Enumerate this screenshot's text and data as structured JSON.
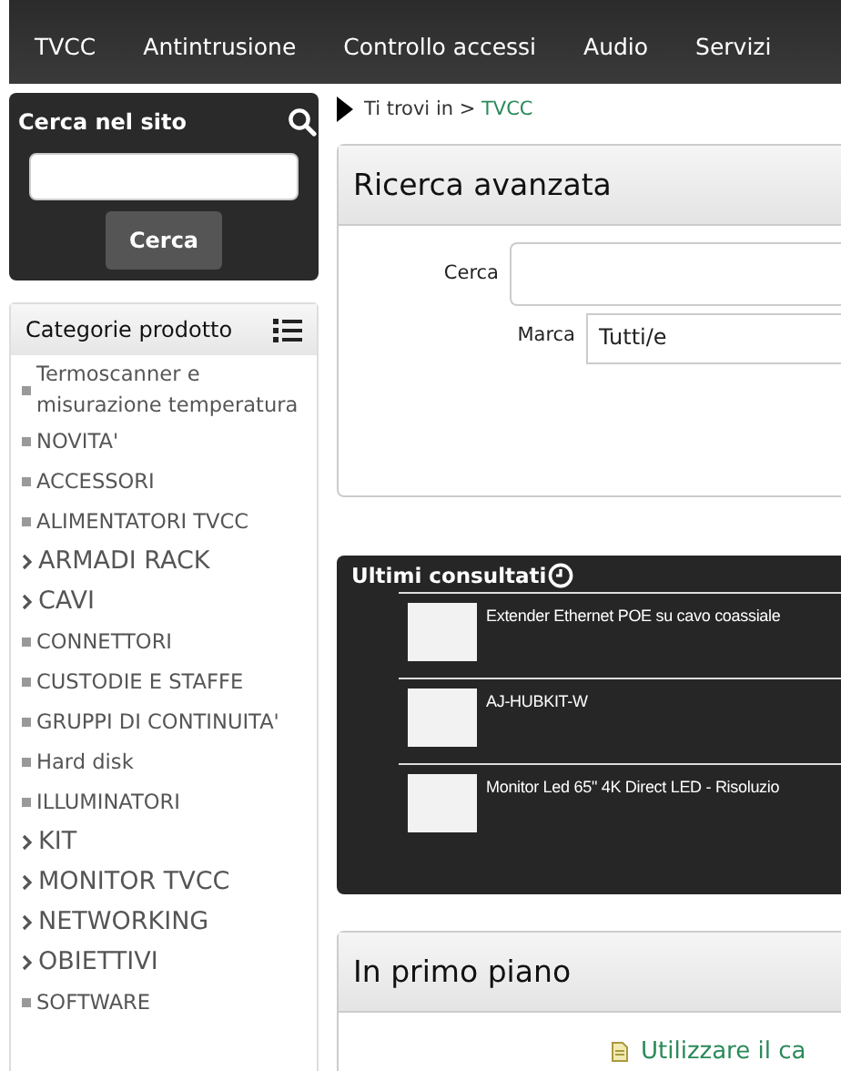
{
  "nav": {
    "items": [
      "TVCC",
      "Antintrusione",
      "Controllo accessi",
      "Audio",
      "Servizi"
    ]
  },
  "site_search": {
    "title": "Cerca nel sito",
    "button": "Cerca"
  },
  "categories": {
    "title": "Categorie prodotto",
    "items": [
      {
        "label": "Termoscanner e misurazione temperatura",
        "kind": "leaf"
      },
      {
        "label": "NOVITA'",
        "kind": "leaf"
      },
      {
        "label": "ACCESSORI",
        "kind": "leaf"
      },
      {
        "label": "ALIMENTATORI TVCC",
        "kind": "leaf"
      },
      {
        "label": "ARMADI RACK",
        "kind": "group"
      },
      {
        "label": "CAVI",
        "kind": "group"
      },
      {
        "label": "CONNETTORI",
        "kind": "leaf"
      },
      {
        "label": "CUSTODIE E STAFFE",
        "kind": "leaf"
      },
      {
        "label": "GRUPPI DI CONTINUITA'",
        "kind": "leaf"
      },
      {
        "label": "Hard disk",
        "kind": "leaf"
      },
      {
        "label": "ILLUMINATORI",
        "kind": "leaf"
      },
      {
        "label": "KIT",
        "kind": "group"
      },
      {
        "label": "MONITOR TVCC",
        "kind": "group"
      },
      {
        "label": "NETWORKING",
        "kind": "group"
      },
      {
        "label": "OBIETTIVI",
        "kind": "group"
      },
      {
        "label": "SOFTWARE",
        "kind": "leaf"
      }
    ]
  },
  "breadcrumb": {
    "prefix": "Ti trovi in",
    "separator": ">",
    "current": "TVCC"
  },
  "advanced_search": {
    "title": "Ricerca avanzata",
    "fields": [
      {
        "label": "Cerca",
        "kind": "text"
      },
      {
        "label": "Marca",
        "kind": "select",
        "value": "Tutti/e"
      }
    ]
  },
  "recent": {
    "title": "Ultimi consultati",
    "items": [
      {
        "name": "Extender Ethernet POE su cavo coassiale"
      },
      {
        "name": "AJ-HUBKIT-W"
      },
      {
        "name": "Monitor Led 65\" 4K Direct LED - Risoluzio"
      }
    ]
  },
  "featured": {
    "title": "In primo piano",
    "link": "Utilizzare il ca"
  }
}
